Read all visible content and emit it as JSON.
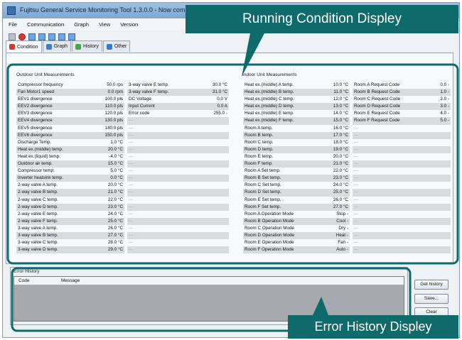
{
  "window": {
    "title": "Fujitsu General Service Monitoring Tool 1.3.0.0 - Now communi...",
    "minimize_label": "_",
    "maximize_label": "□",
    "close_label": "X"
  },
  "menu": [
    "File",
    "Communication",
    "Graph",
    "View",
    "Version"
  ],
  "tabs": [
    {
      "label": "Condition",
      "icon": "condition-icon",
      "color": "#d23b32",
      "active": true
    },
    {
      "label": "Graph",
      "icon": "graph-icon",
      "color": "#3c7fd1"
    },
    {
      "label": "History",
      "icon": "history-icon",
      "color": "#46a84e"
    },
    {
      "label": "Other",
      "icon": "other-icon",
      "color": "#2f7fc8"
    }
  ],
  "outdoor": {
    "title": "Outdoor Unit Measurements",
    "left": [
      {
        "label": "Compressor frequency",
        "value": "50.0 rps"
      },
      {
        "label": "Fan Motor1 speed",
        "value": "0.0 rpm"
      },
      {
        "label": "EEV1 divergence",
        "value": "100.0 pls"
      },
      {
        "label": "EEV2 divergence",
        "value": "110.0 pls"
      },
      {
        "label": "EEV3 divergence",
        "value": "120.0 pls"
      },
      {
        "label": "EEV4 divergence",
        "value": "130.0 pls"
      },
      {
        "label": "EEV5 divergence",
        "value": "140.0 pls"
      },
      {
        "label": "EEV6 divergence",
        "value": "150.0 pls"
      },
      {
        "label": "Discharge Temp.",
        "value": "1.0 °C"
      },
      {
        "label": "Heat ex.(middle) temp.",
        "value": "20.0 °C"
      },
      {
        "label": "Heat ex.(liquid) temp.",
        "value": "-4.0 °C"
      },
      {
        "label": "Outdoor air temp.",
        "value": "15.0 °C"
      },
      {
        "label": "Compressor temp.",
        "value": "5.0 °C"
      },
      {
        "label": "Inverter heatsink temp.",
        "value": "0.0 °C"
      },
      {
        "label": "2-way valve A temp.",
        "value": "20.0 °C"
      },
      {
        "label": "2-way valve B temp.",
        "value": "21.0 °C"
      },
      {
        "label": "2-way valve C temp.",
        "value": "22.0 °C"
      },
      {
        "label": "2-way valve D temp.",
        "value": "23.0 °C"
      },
      {
        "label": "2-way valve E temp.",
        "value": "24.0 °C"
      },
      {
        "label": "2-way valve F temp.",
        "value": "25.0 °C"
      },
      {
        "label": "3-way valve A temp.",
        "value": "26.0 °C"
      },
      {
        "label": "3-way valve B temp.",
        "value": "27.0 °C"
      },
      {
        "label": "3-way valve C temp.",
        "value": "28.0 °C"
      },
      {
        "label": "3-way valve D temp.",
        "value": "29.0 °C"
      }
    ],
    "right": [
      {
        "label": "3-way valve E temp.",
        "value": "30.0 °C"
      },
      {
        "label": "3-way valve F temp.",
        "value": "31.0 °C"
      },
      {
        "label": "DC Voltage",
        "value": "0.0 V"
      },
      {
        "label": "Input Current",
        "value": "0.0 A"
      },
      {
        "label": "Error code",
        "value": "255.0 -"
      },
      {
        "label": "---",
        "value": ""
      },
      {
        "label": "---",
        "value": ""
      },
      {
        "label": "---",
        "value": ""
      },
      {
        "label": "---",
        "value": ""
      },
      {
        "label": "---",
        "value": ""
      },
      {
        "label": "---",
        "value": ""
      },
      {
        "label": "---",
        "value": ""
      },
      {
        "label": "---",
        "value": ""
      },
      {
        "label": "---",
        "value": ""
      },
      {
        "label": "---",
        "value": ""
      },
      {
        "label": "---",
        "value": ""
      },
      {
        "label": "---",
        "value": ""
      },
      {
        "label": "---",
        "value": ""
      },
      {
        "label": "---",
        "value": ""
      },
      {
        "label": "---",
        "value": ""
      },
      {
        "label": "---",
        "value": ""
      },
      {
        "label": "---",
        "value": ""
      },
      {
        "label": "---",
        "value": ""
      },
      {
        "label": "---",
        "value": ""
      }
    ]
  },
  "indoor": {
    "title": "Indoor Unit Measurements",
    "left": [
      {
        "label": "Heat ex.(middle) A temp.",
        "value": "10.0 °C"
      },
      {
        "label": "Heat ex.(middle) B temp.",
        "value": "11.0 °C"
      },
      {
        "label": "Heat ex.(middle) C temp.",
        "value": "12.0 °C"
      },
      {
        "label": "Heat ex.(middle) D temp.",
        "value": "13.0 °C"
      },
      {
        "label": "Heat ex.(middle) E temp.",
        "value": "14.0 °C"
      },
      {
        "label": "Heat ex.(middle) F temp.",
        "value": "15.0 °C"
      },
      {
        "label": "Room A temp.",
        "value": "16.0 °C"
      },
      {
        "label": "Room B temp.",
        "value": "17.0 °C"
      },
      {
        "label": "Room C temp.",
        "value": "18.0 °C"
      },
      {
        "label": "Room D temp.",
        "value": "19.0 °C"
      },
      {
        "label": "Room E temp.",
        "value": "20.0 °C"
      },
      {
        "label": "Room F temp.",
        "value": "21.0 °C"
      },
      {
        "label": "Room A Set temp.",
        "value": "22.0 °C"
      },
      {
        "label": "Room B Set temp.",
        "value": "23.0 °C"
      },
      {
        "label": "Room C Set temp.",
        "value": "24.0 °C"
      },
      {
        "label": "Room D Set temp.",
        "value": "25.0 °C"
      },
      {
        "label": "Room E Set temp.",
        "value": "26.0 °C"
      },
      {
        "label": "Room F Set temp.",
        "value": "27.0 °C"
      },
      {
        "label": "Room A Operation Mode",
        "value": "Stop -"
      },
      {
        "label": "Room B Operation Mode",
        "value": "Cool -"
      },
      {
        "label": "Room C Operation Mode",
        "value": "Dry -"
      },
      {
        "label": "Room D Operation Mode",
        "value": "Heat -"
      },
      {
        "label": "Room E Operation Mode",
        "value": "Fan -"
      },
      {
        "label": "Room F Operation Mode",
        "value": "Auto -"
      }
    ],
    "right": [
      {
        "label": "Room A Request Code",
        "value": "0.0 -"
      },
      {
        "label": "Room B Request Code",
        "value": "1.0 -"
      },
      {
        "label": "Room C Request Code",
        "value": "2.0 -"
      },
      {
        "label": "Room D Request Code",
        "value": "3.0 -"
      },
      {
        "label": "Room E Request Code",
        "value": "4.0 -"
      },
      {
        "label": "Room F Request Code",
        "value": "5.0 -"
      },
      {
        "label": "---",
        "value": ""
      },
      {
        "label": "---",
        "value": ""
      },
      {
        "label": "---",
        "value": ""
      },
      {
        "label": "---",
        "value": ""
      },
      {
        "label": "---",
        "value": ""
      },
      {
        "label": "---",
        "value": ""
      },
      {
        "label": "---",
        "value": ""
      },
      {
        "label": "---",
        "value": ""
      },
      {
        "label": "---",
        "value": ""
      },
      {
        "label": "---",
        "value": ""
      },
      {
        "label": "---",
        "value": ""
      },
      {
        "label": "---",
        "value": ""
      },
      {
        "label": "---",
        "value": ""
      },
      {
        "label": "---",
        "value": ""
      },
      {
        "label": "---",
        "value": ""
      },
      {
        "label": "---",
        "value": ""
      },
      {
        "label": "---",
        "value": ""
      },
      {
        "label": "---",
        "value": ""
      }
    ]
  },
  "error_history": {
    "title": "Error History",
    "columns": [
      "Code",
      "Message"
    ]
  },
  "buttons": {
    "get_history": "Get history",
    "save": "Save...",
    "clear": "Clear"
  },
  "callouts": {
    "running": "Running Condition Displey",
    "error": "Error History Displey",
    "color": "#0f6a6b"
  }
}
